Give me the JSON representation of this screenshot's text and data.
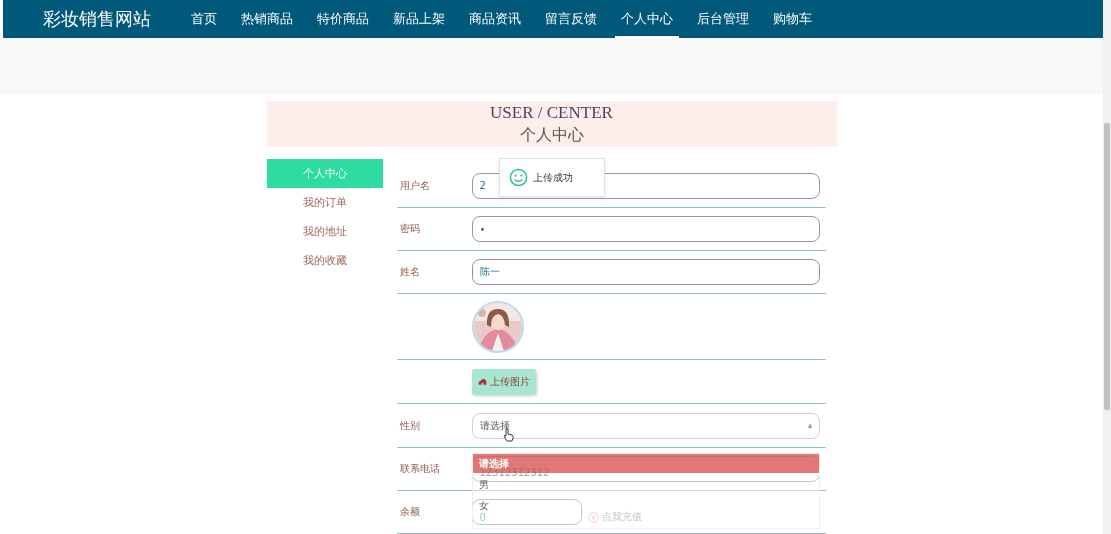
{
  "site_title": "彩妆销售网站",
  "nav": [
    {
      "label": "首页",
      "selected": false
    },
    {
      "label": "热销商品",
      "selected": false
    },
    {
      "label": "特价商品",
      "selected": false
    },
    {
      "label": "新品上架",
      "selected": false
    },
    {
      "label": "商品资讯",
      "selected": false
    },
    {
      "label": "留言反馈",
      "selected": false
    },
    {
      "label": "个人中心",
      "selected": true
    },
    {
      "label": "后台管理",
      "selected": false
    },
    {
      "label": "购物车",
      "selected": false
    }
  ],
  "header": {
    "title_en": "USER / CENTER",
    "title_cn": "个人中心"
  },
  "sidebar": [
    {
      "label": "个人中心",
      "selected": true
    },
    {
      "label": "我的订单",
      "selected": false
    },
    {
      "label": "我的地址",
      "selected": false
    },
    {
      "label": "我的收藏",
      "selected": false
    }
  ],
  "toast": {
    "message": "上传成功"
  },
  "form": [
    {
      "kind": "text",
      "label": "用户名",
      "value": "2"
    },
    {
      "kind": "text",
      "label": "密码",
      "value": "•"
    },
    {
      "kind": "text",
      "label": "姓名",
      "value": "陈一"
    },
    {
      "kind": "avatar"
    },
    {
      "kind": "upload",
      "button": "上传图片"
    },
    {
      "kind": "select",
      "label": "性别",
      "value": "请选择"
    },
    {
      "kind": "text",
      "label": "联系电话",
      "value": "12312312312"
    },
    {
      "kind": "balance",
      "label": "余额",
      "value": "0",
      "link": "点我充值"
    }
  ],
  "dropdown": {
    "options": [
      {
        "label": "请选择",
        "selected": true
      },
      {
        "label": "男",
        "selected": false
      },
      {
        "label": "女",
        "selected": false
      }
    ]
  }
}
